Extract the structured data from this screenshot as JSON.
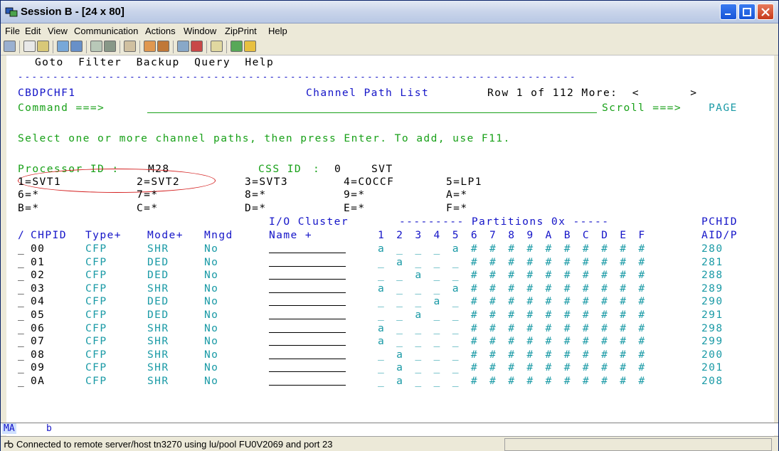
{
  "window": {
    "title": "Session B - [24 x 80]"
  },
  "menu": [
    "File",
    "Edit",
    "View",
    "Communication",
    "Actions",
    "Window",
    "ZipPrint",
    "Help"
  ],
  "terminal": {
    "action_bar": "Goto  Filter  Backup  Query  Help",
    "divider": "--------------------------------------------------------------------------------",
    "panel_id": "CBDPCHF1",
    "panel_title": "Channel Path List",
    "row_info": "Row 1 of 112 More:  <       >",
    "command_label": "Command ===>",
    "scroll_label": "Scroll ===>",
    "scroll_value": "PAGE",
    "instruction": "Select one or more channel paths, then press Enter. To add, use F11.",
    "processor_label": "Processor ID :",
    "processor_value": "M28",
    "css_label": "CSS ID",
    "css_sep": ":",
    "css_value": "0",
    "css_name": "SVT",
    "partition_map": [
      [
        "1=SVT1",
        "2=SVT2",
        "3=SVT3",
        "4=COCCF",
        "5=LP1"
      ],
      [
        "6=*",
        "7=*",
        "8=*",
        "9=*",
        "A=*"
      ],
      [
        "B=*",
        "C=*",
        "D=*",
        "E=*",
        "F=*"
      ]
    ],
    "header1": {
      "io_cluster": "I/O Cluster",
      "partitions": "--------- Partitions 0x -----",
      "pchid": "PCHID"
    },
    "header2": {
      "slash": "/",
      "chpid": "CHPID",
      "type": "Type+",
      "mode": "Mode+",
      "mngd": "Mngd",
      "name": "Name +",
      "cols": "1 2 3 4 5 6 7 8 9 A B C D E F",
      "aidp": "AID/P"
    },
    "rows": [
      {
        "sel": "_",
        "chpid": "00",
        "type": "CFP",
        "mode": "SHR",
        "mngd": "No",
        "parts": "a _ _ _ a # # # # # # # # # #",
        "pchid": "280"
      },
      {
        "sel": "_",
        "chpid": "01",
        "type": "CFP",
        "mode": "DED",
        "mngd": "No",
        "parts": "_ a _ _ _ # # # # # # # # # #",
        "pchid": "281"
      },
      {
        "sel": "_",
        "chpid": "02",
        "type": "CFP",
        "mode": "DED",
        "mngd": "No",
        "parts": "_ _ a _ _ # # # # # # # # # #",
        "pchid": "288"
      },
      {
        "sel": "_",
        "chpid": "03",
        "type": "CFP",
        "mode": "SHR",
        "mngd": "No",
        "parts": "a _ _ _ a # # # # # # # # # #",
        "pchid": "289"
      },
      {
        "sel": "_",
        "chpid": "04",
        "type": "CFP",
        "mode": "DED",
        "mngd": "No",
        "parts": "_ _ _ a _ # # # # # # # # # #",
        "pchid": "290"
      },
      {
        "sel": "_",
        "chpid": "05",
        "type": "CFP",
        "mode": "DED",
        "mngd": "No",
        "parts": "_ _ a _ _ # # # # # # # # # #",
        "pchid": "291"
      },
      {
        "sel": "_",
        "chpid": "06",
        "type": "CFP",
        "mode": "SHR",
        "mngd": "No",
        "parts": "a _ _ _ _ # # # # # # # # # #",
        "pchid": "298"
      },
      {
        "sel": "_",
        "chpid": "07",
        "type": "CFP",
        "mode": "SHR",
        "mngd": "No",
        "parts": "a _ _ _ _ # # # # # # # # # #",
        "pchid": "299"
      },
      {
        "sel": "_",
        "chpid": "08",
        "type": "CFP",
        "mode": "SHR",
        "mngd": "No",
        "parts": "_ a _ _ _ # # # # # # # # # #",
        "pchid": "200"
      },
      {
        "sel": "_",
        "chpid": "09",
        "type": "CFP",
        "mode": "SHR",
        "mngd": "No",
        "parts": "_ a _ _ _ # # # # # # # # # #",
        "pchid": "201"
      },
      {
        "sel": "_",
        "chpid": "0A",
        "type": "CFP",
        "mode": "SHR",
        "mngd": "No",
        "parts": "_ a _ _ _ # # # # # # # # # #",
        "pchid": "208"
      }
    ]
  },
  "oia": {
    "ma": "MA",
    "indicator": "b"
  },
  "status": {
    "message": "Connected to remote server/host tn3270 using lu/pool FU0V2069 and port 23"
  },
  "colors": {
    "text_black": "#000000",
    "field_green": "#19a119",
    "header_blue": "#1414c8",
    "data_teal": "#1a9aa6",
    "highlight_red": "#d42020"
  }
}
